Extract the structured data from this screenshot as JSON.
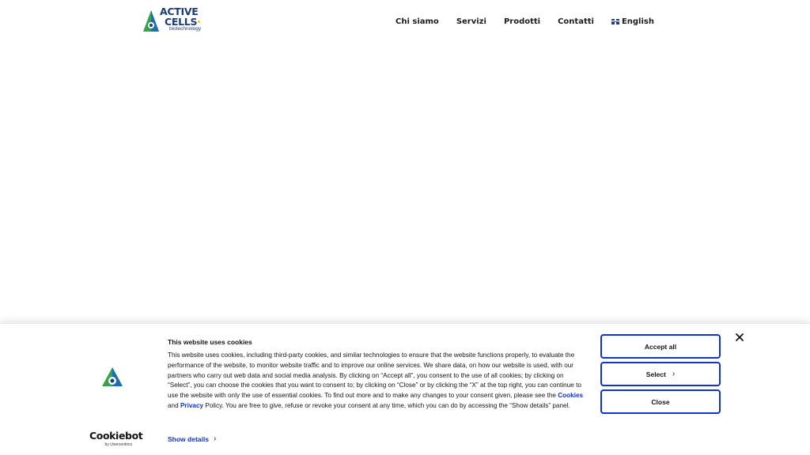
{
  "header": {
    "logo": {
      "line1": "ACTIVE",
      "line2": "CELLS",
      "line3": "biotechnology"
    },
    "nav": {
      "items": [
        "Chi siamo",
        "Servizi",
        "Prodotti",
        "Contatti"
      ],
      "language": "English"
    }
  },
  "cookie_banner": {
    "title": "This website uses cookies",
    "body_part1": "This website uses cookies, including third-party cookies, and similar technologies to ensure that the website functions properly, to evaluate the performance of the website, to monitor website traffic and to improve our online services. We share data, on how our website is used, with our partners who carry out web data and social media analysis. By clicking on “Accept all”, you consent to the use of all cookies; by clicking on “Select”, you can choose the cookies that you want to consent to; by clicking on “Close” or by clicking the “X” at the top right, you can continue to use the website with only the use of essential cookies. To find out more and to make any changes to your consent given, please see the ",
    "cookies_link": "Cookies",
    "and": " and ",
    "privacy_link": "Privacy",
    "body_part2": " Policy. You are free to give, refuse or revoke your consent at any time, which you can do by accessing the “Show details” panel.",
    "show_details": "Show details",
    "buttons": {
      "accept_all": "Accept all",
      "select": "Select",
      "close": "Close"
    },
    "brand": {
      "name": "Cookiebot",
      "sub": "by Usercentrics"
    }
  },
  "colors": {
    "link_blue": "#1032cf",
    "logo_navy": "#1a3d7a",
    "logo_green": "#3aa14a",
    "logo_yellow": "#f2c531"
  },
  "icons": [
    "close-icon",
    "chevron-right-icon",
    "uk-flag-icon",
    "logo-icon"
  ]
}
